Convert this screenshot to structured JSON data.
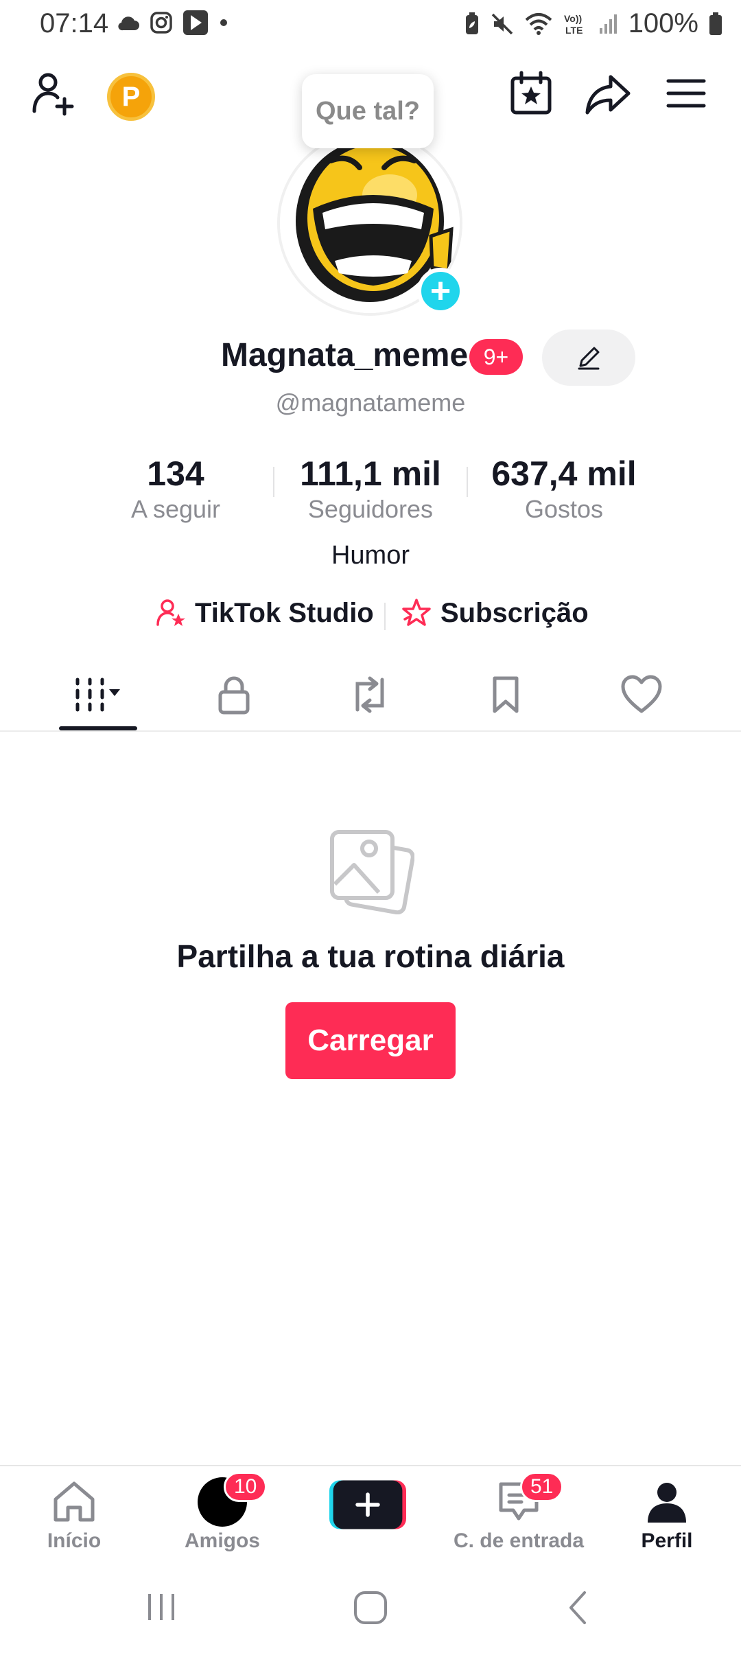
{
  "status_bar": {
    "time": "07:14",
    "battery": "100%",
    "left_icons": [
      "cloud-icon",
      "instagram-icon",
      "play-store-icon",
      "dot-icon"
    ],
    "right_icons": [
      "battery-saver-icon",
      "mute-icon",
      "wifi-icon",
      "volte-icon",
      "signal-icon",
      "battery-icon"
    ]
  },
  "header": {
    "coin_label": "P",
    "tooltip": "Que tal?",
    "icons": [
      "add-friend-icon",
      "coin-icon",
      "calendar-star-icon",
      "share-icon",
      "menu-icon"
    ]
  },
  "profile": {
    "display_name": "Magnata_meme",
    "badge": "9+",
    "handle": "@magnatameme",
    "bio": "Humor"
  },
  "stats": [
    {
      "value": "134",
      "label": "A seguir"
    },
    {
      "value": "111,1 mil",
      "label": "Seguidores"
    },
    {
      "value": "637,4 mil",
      "label": "Gostos"
    }
  ],
  "links": {
    "studio": "TikTok Studio",
    "subscription": "Subscrição"
  },
  "tabs": [
    "grid-icon",
    "lock-icon",
    "repost-icon",
    "bookmark-icon",
    "heart-icon"
  ],
  "empty_state": {
    "message": "Partilha a tua rotina diária",
    "button": "Carregar"
  },
  "bottom_nav": {
    "items": [
      {
        "label": "Início",
        "badge": ""
      },
      {
        "label": "Amigos",
        "badge": "10"
      },
      {
        "label": "",
        "badge": ""
      },
      {
        "label": "C. de entrada",
        "badge": "51"
      },
      {
        "label": "Perfil",
        "badge": ""
      }
    ]
  },
  "colors": {
    "accent": "#fe2c55",
    "cyan": "#20d5ec",
    "text": "#161823",
    "muted": "#8a8b91"
  }
}
